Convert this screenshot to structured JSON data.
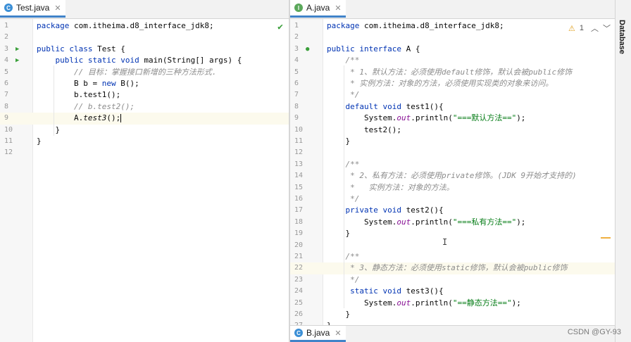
{
  "left": {
    "tab": {
      "label": "Test.java",
      "icon": "class-icon",
      "icon_letter": "C",
      "icon_color": "#3b8fd6"
    },
    "lines": [
      {
        "n": "1",
        "html": "<span class='kw'>package</span> com.itheima.d8_interface_jdk8;"
      },
      {
        "n": "2",
        "html": ""
      },
      {
        "n": "3",
        "html": "<span class='kw'>public class</span> Test {",
        "mark": "▶"
      },
      {
        "n": "4",
        "html": "    <span class='kw'>public static void</span> main(String[] args) {",
        "mark": "▶"
      },
      {
        "n": "5",
        "html": "        <span class='cm'>// 目标：掌握接口新增的三种方法形式.</span>"
      },
      {
        "n": "6",
        "html": "        B b = <span class='kw'>new</span> B();"
      },
      {
        "n": "7",
        "html": "        b.test1();"
      },
      {
        "n": "8",
        "html": "        <span class='cm'>// b.test2();</span>"
      },
      {
        "n": "9",
        "html": "        A.<i>test3</i>();",
        "current": true
      },
      {
        "n": "10",
        "html": "    }"
      },
      {
        "n": "11",
        "html": "}"
      },
      {
        "n": "12",
        "html": ""
      }
    ]
  },
  "right": {
    "tab": {
      "label": "A.java",
      "icon": "interface-icon",
      "icon_letter": "I",
      "icon_color": "#5ba85b"
    },
    "warning_count": "1",
    "lines": [
      {
        "n": "1",
        "html": "<span class='kw'>package</span> com.itheima.d8_interface_jdk8;"
      },
      {
        "n": "2",
        "html": ""
      },
      {
        "n": "3",
        "html": "<span class='kw'>public interface</span> A {",
        "mark": "●"
      },
      {
        "n": "4",
        "html": "    <span class='cm'>/**</span>"
      },
      {
        "n": "5",
        "html": "    <span class='cm'> * 1、默认方法：必须使用default修饰，默认会被public修饰</span>"
      },
      {
        "n": "6",
        "html": "    <span class='cm'> * 实例方法：对象的方法，必须使用实现类的对象来访问。</span>"
      },
      {
        "n": "7",
        "html": "    <span class='cm'> */</span>"
      },
      {
        "n": "8",
        "html": "    <span class='kw'>default void</span> test1(){"
      },
      {
        "n": "9",
        "html": "        System.<span class='fd'>out</span>.println(<span class='st'>\"===默认方法==\"</span>);"
      },
      {
        "n": "10",
        "html": "        test2();"
      },
      {
        "n": "11",
        "html": "    }"
      },
      {
        "n": "12",
        "html": ""
      },
      {
        "n": "13",
        "html": "    <span class='cm'>/**</span>"
      },
      {
        "n": "14",
        "html": "    <span class='cm'> * 2、私有方法：必须使用private修饰。(JDK 9开始才支持的)</span>"
      },
      {
        "n": "15",
        "html": "    <span class='cm'> *   实例方法：对象的方法。</span>"
      },
      {
        "n": "16",
        "html": "    <span class='cm'> */</span>"
      },
      {
        "n": "17",
        "html": "    <span class='kw'>private void</span> test2(){"
      },
      {
        "n": "18",
        "html": "        System.<span class='fd'>out</span>.println(<span class='st'>\"===私有方法==\"</span>);"
      },
      {
        "n": "19",
        "html": "    }"
      },
      {
        "n": "20",
        "html": ""
      },
      {
        "n": "21",
        "html": "    <span class='cm'>/**</span>"
      },
      {
        "n": "22",
        "html": "    <span class='cm'> * 3、静态方法：必须使用static修饰，默认会被public修饰</span>",
        "current": true
      },
      {
        "n": "23",
        "html": "    <span class='cm'> */</span>"
      },
      {
        "n": "24",
        "html": "     <span class='kw'>static void</span> test3(){"
      },
      {
        "n": "25",
        "html": "        System.<span class='fd'>out</span>.println(<span class='st'>\"==静态方法==\"</span>);"
      },
      {
        "n": "26",
        "html": "    }"
      },
      {
        "n": "27",
        "html": "}"
      }
    ]
  },
  "bottom_tab": {
    "label": "B.java",
    "icon": "class-icon",
    "icon_letter": "C",
    "icon_color": "#3b8fd6"
  },
  "sidebar_label": "Database",
  "watermark": "CSDN @GY-93",
  "colors": {
    "keyword": "#0033b3",
    "comment": "#8c8c8c",
    "string": "#067d17",
    "field": "#871094",
    "tab_accent": "#4083c9"
  }
}
